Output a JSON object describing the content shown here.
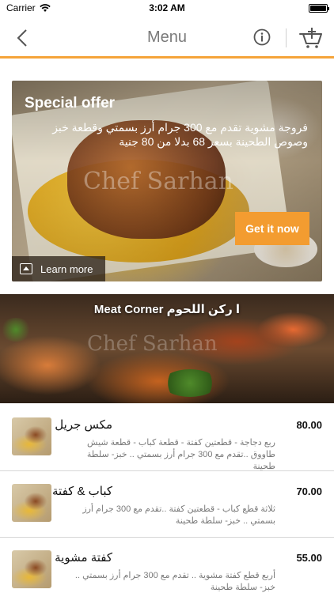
{
  "status_bar": {
    "carrier": "Carrier",
    "time": "3:02 AM"
  },
  "nav": {
    "title": "Menu",
    "back_icon": "chevron-left-icon",
    "info_icon": "info-icon",
    "cart_icon": "cart-add-icon"
  },
  "offer": {
    "title": "Special offer",
    "description": "فروجة مشوية تقدم مع 300 جرام أرز بسمتي وقطعة خبز وصوص الطحينة بسعر 68 بدلا من 80 جنية",
    "watermark": "Chef Sarhan",
    "button_label": "Get it now",
    "learn_more_label": "Learn more"
  },
  "category": {
    "title": "Meat Corner ا ركن اللحوم",
    "watermark": "Chef Sarhan"
  },
  "items": [
    {
      "name": "مكس جريل",
      "description": "ربع دجاجة - قطعتين كفتة - قطعة كباب - قطعة شيش طاووق ..تقدم مع 300 جرام أرز بسمتي .. خبز- سلطة طحينة",
      "price": "80.00"
    },
    {
      "name": "كباب & كفتة",
      "description": "ثلاثة قطع كباب - قطعتين كفتة ..تقدم مع 300 جرام أرز بسمتي .. خبز- سلطة طحينة",
      "price": "70.00"
    },
    {
      "name": "كفتة مشوية",
      "description": "أربع قطع كفتة مشوية .. تقدم مع 300 جرام أرز بسمتي .. خبز- سلطة طحينة",
      "price": "55.00"
    }
  ],
  "colors": {
    "accent": "#f39c30",
    "divider": "#f5a43a"
  }
}
